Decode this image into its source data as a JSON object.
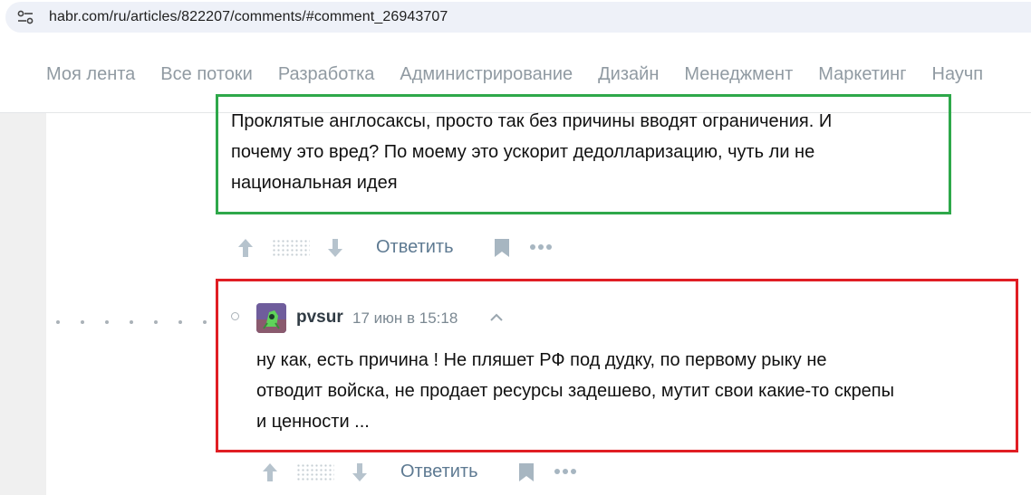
{
  "browser": {
    "url": "habr.com/ru/articles/822207/comments/#comment_26943707",
    "site_icon": "tune-icon"
  },
  "nav": {
    "items": [
      "Моя лента",
      "Все потоки",
      "Разработка",
      "Администрирование",
      "Дизайн",
      "Менеджмент",
      "Маркетинг",
      "Научп"
    ]
  },
  "comments": [
    {
      "lines": [
        "Проклятые англосаксы, просто так без причины вводят ограничения. И",
        "почему это вред? По моему это ускорит дедолларизацию, чуть ли не",
        "национальная идея"
      ],
      "highlight_color": "#2ea84a",
      "actions": {
        "reply_label": "Ответить"
      }
    },
    {
      "author": "pvsur",
      "timestamp": "17 июн в 15:18",
      "lines": [
        "ну как, есть причина ! Не пляшет РФ под дудку, по первому рыку не",
        "отводит войска, не продает ресурсы задешево, мутит свои какие-то скрепы",
        "и ценности ..."
      ],
      "highlight_color": "#e01e24",
      "actions": {
        "reply_label": "Ответить"
      }
    }
  ],
  "icons": [
    "upvote-icon",
    "downvote-icon",
    "bookmark-icon",
    "more-icon",
    "collapse-icon"
  ]
}
